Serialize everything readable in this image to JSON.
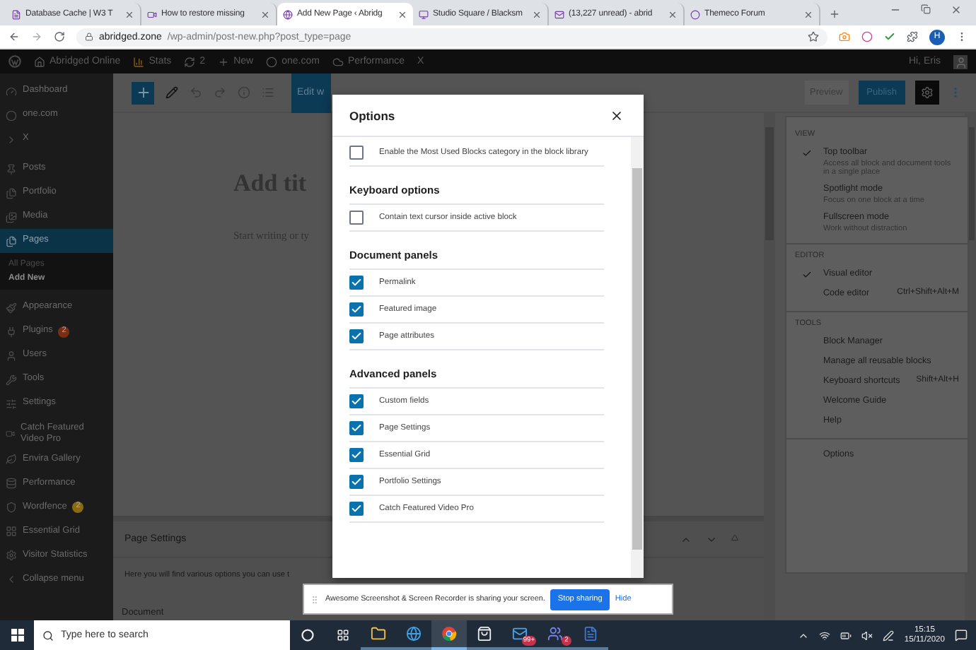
{
  "browser": {
    "tabs": [
      {
        "title": "Database Cache | W3 T",
        "selected": false
      },
      {
        "title": "How to restore missing",
        "selected": false
      },
      {
        "title": "Add New Page ‹ Abridg",
        "selected": true
      },
      {
        "title": "Studio Square / Blacksm",
        "selected": false
      },
      {
        "title": "(13,227 unread) - abrid",
        "selected": false
      },
      {
        "title": "Themeco Forum",
        "selected": false
      }
    ],
    "url_host": "abridged.zone",
    "url_path": "/wp-admin/post-new.php?post_type=page",
    "profile_initial": "H"
  },
  "admin_bar": {
    "items": [
      "Abridged Online",
      "Stats",
      "2",
      "New",
      "one.com",
      "Performance",
      "X"
    ],
    "greeting": "Hi, Eris"
  },
  "sidebar": {
    "groups": [
      {
        "items": [
          {
            "label": "Dashboard",
            "selected": false
          },
          {
            "label": "one.com",
            "selected": false
          },
          {
            "label": "X",
            "selected": false
          }
        ]
      },
      {
        "items": [
          {
            "label": "Posts",
            "selected": false
          },
          {
            "label": "Portfolio",
            "selected": false
          },
          {
            "label": "Media",
            "selected": false
          },
          {
            "label": "Pages",
            "selected": true,
            "children": [
              {
                "label": "All Pages",
                "selected": false
              },
              {
                "label": "Add New",
                "selected": true
              }
            ]
          }
        ]
      },
      {
        "items": [
          {
            "label": "Appearance",
            "selected": false
          },
          {
            "label": "Plugins",
            "selected": false,
            "badge": {
              "text": "2",
              "color": "#7a2e12"
            }
          },
          {
            "label": "Users",
            "selected": false
          },
          {
            "label": "Tools",
            "selected": false
          },
          {
            "label": "Settings",
            "selected": false
          }
        ]
      },
      {
        "items": [
          {
            "label": "Catch Featured Video Pro",
            "selected": false
          },
          {
            "label": "Envira Gallery",
            "selected": false
          },
          {
            "label": "Performance",
            "selected": false
          },
          {
            "label": "Wordfence",
            "selected": false,
            "badge": {
              "text": "2",
              "color": "#8a6a12"
            }
          },
          {
            "label": "Essential Grid",
            "selected": false
          },
          {
            "label": "Visitor Statistics",
            "selected": false
          },
          {
            "label": "Collapse menu",
            "selected": false
          }
        ]
      }
    ]
  },
  "editor": {
    "edit_button": "Edit w",
    "preview": "Preview",
    "publish": "Publish",
    "title_placeholder": "Add tit",
    "body_placeholder": "Start writing or ty",
    "panel": {
      "title": "Page Settings",
      "text": "Here you will find various options you can use t"
    },
    "footer_tab": "Document"
  },
  "more_menu": {
    "sections": [
      {
        "heading": "VIEW",
        "items": [
          {
            "label": "Top toolbar",
            "description": "Access all block and document tools in a single place",
            "checked": true
          },
          {
            "label": "Spotlight mode",
            "description": "Focus on one block at a time",
            "checked": false
          },
          {
            "label": "Fullscreen mode",
            "description": "Work without distraction",
            "checked": false
          }
        ]
      },
      {
        "heading": "EDITOR",
        "items": [
          {
            "label": "Visual editor",
            "checked": true
          },
          {
            "label": "Code editor",
            "shortcut": "Ctrl+Shift+Alt+M",
            "checked": false
          }
        ]
      },
      {
        "heading": "TOOLS",
        "items": [
          {
            "label": "Block Manager"
          },
          {
            "label": "Manage all reusable blocks"
          },
          {
            "label": "Keyboard shortcuts",
            "shortcut": "Shift+Alt+H"
          },
          {
            "label": "Welcome Guide"
          },
          {
            "label": "Help"
          }
        ]
      },
      {
        "items": [
          {
            "label": "Options"
          }
        ]
      }
    ]
  },
  "options_dialog": {
    "title": "Options",
    "sections": [
      {
        "options": [
          {
            "label": "Enable the Most Used Blocks category in the block library",
            "checked": false
          }
        ]
      },
      {
        "heading": "Keyboard options",
        "options": [
          {
            "label": "Contain text cursor inside active block",
            "checked": false
          }
        ]
      },
      {
        "heading": "Document panels",
        "options": [
          {
            "label": "Permalink",
            "checked": true
          },
          {
            "label": "Featured image",
            "checked": true
          },
          {
            "label": "Page attributes",
            "checked": true
          }
        ]
      },
      {
        "heading": "Advanced panels",
        "options": [
          {
            "label": "Custom fields",
            "checked": true
          },
          {
            "label": "Page Settings",
            "checked": true
          },
          {
            "label": "Essential Grid",
            "checked": true
          },
          {
            "label": "Portfolio Settings",
            "checked": true
          },
          {
            "label": "Catch Featured Video Pro",
            "checked": true
          }
        ]
      }
    ]
  },
  "share_bar": {
    "message": "Awesome Screenshot & Screen Recorder is sharing your screen.",
    "stop_button": "Stop sharing",
    "hide_link": "Hide"
  },
  "taskbar": {
    "search_placeholder": "Type here to search",
    "apps": [
      {
        "selected": false
      },
      {
        "selected": false
      },
      {
        "selected": true
      },
      {
        "selected": false
      },
      {
        "selected": false,
        "badge": "99+"
      },
      {
        "selected": false,
        "badge": "2"
      },
      {
        "selected": false
      }
    ],
    "time": "15:15",
    "date": "15/11/2020"
  }
}
